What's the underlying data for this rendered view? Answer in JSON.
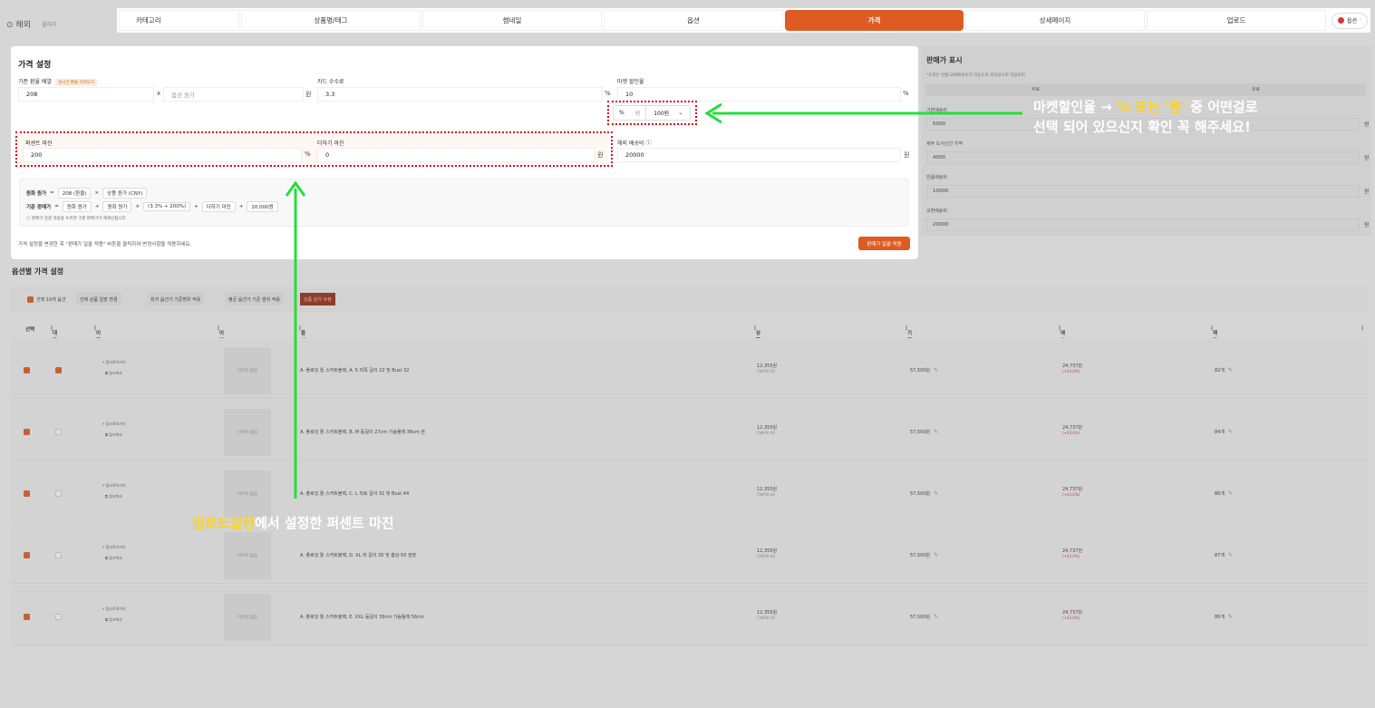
{
  "topbar": {
    "brand": "해외",
    "sub": "불러라"
  },
  "tabs": [
    {
      "label": "카테고리",
      "active": false
    },
    {
      "label": "상품명/태그",
      "active": false
    },
    {
      "label": "썸네일",
      "active": false
    },
    {
      "label": "옵션",
      "active": false
    },
    {
      "label": "가격",
      "active": true
    },
    {
      "label": "상세페이지",
      "active": false
    },
    {
      "label": "업로드",
      "active": false
    }
  ],
  "lang": {
    "label": "옵션"
  },
  "price_settings": {
    "title": "가격 설정",
    "base_rate_label": "기준 환율 배열",
    "base_rate_badge": "실시간 환율 가져오기",
    "base_rate_value": "208",
    "times": "x",
    "option_cost_placeholder": "옵션 원가",
    "won": "원",
    "card_fee_label": "카드 수수료",
    "card_fee_value": "3.3",
    "percent": "%",
    "market_discount_label": "마켓 할인율",
    "market_discount_value": "10",
    "toggle_percent": "%",
    "toggle_won": "원",
    "toggle_select": "100원",
    "percent_margin_label": "퍼센트 마진",
    "percent_margin_value": "200",
    "add_margin_label": "더하기 마진",
    "add_margin_value": "0",
    "overseas_shipping_label": "해외 배송비",
    "overseas_shipping_value": "20000",
    "formula": {
      "row1_label": "원화 원가",
      "eq": "=",
      "row1_chip1": "208 (환율)",
      "mult": "×",
      "row1_chip2": "상품 원가 (CNY)",
      "row2_label": "기준 판매가",
      "row2_chip1": "원화 원가",
      "plus": "+",
      "row2_chip2": "원화 원가",
      "row2_chip3": "(3.3% + 200%)",
      "row2_chip4": "더하기 마진",
      "row2_chip5": "20,000원",
      "note": "판매가 일괄 적용을 누르면 기준 판매가가 재계산됩니다."
    },
    "hint": "가격 설정을 변경한 후 \"판매가 일괄 적용\" 버튼을 클릭하여 변경사항을 적용하세요.",
    "apply_button": "판매가 일괄 적용"
  },
  "sale_display": {
    "title": "판매가 표시",
    "subtitle": "*유료인 반품/교환배송비가 자동으로 최대값으로 적용되며",
    "col1": "무료",
    "col2": "유료",
    "fields": [
      {
        "label": "기본배송비",
        "value": "5000"
      },
      {
        "label": "제주 도서산간 지역",
        "value": "4000"
      },
      {
        "label": "반품배송비",
        "value": "10000"
      },
      {
        "label": "교환배송비",
        "value": "20000"
      }
    ],
    "unit": "원"
  },
  "options": {
    "title": "옵션별 가격 설정",
    "toolbar": {
      "select_count": "선택 10개 옵션",
      "bulk_change": "선택 상품 일괄 변경",
      "min_range": "최저 옵션가 기준범위 적용",
      "avg_range": "평균 옵션가 기준 범위 적용",
      "edit_cost": "상품 원가 수정"
    },
    "headers": {
      "select": "선택",
      "rep": "대표상품",
      "move": "이동",
      "image": "이미지",
      "name": "옵션명",
      "cost": "상품 원가",
      "base_price": "기준 판매가",
      "profit": "예상 순마진",
      "stock": "재고"
    },
    "rows": [
      {
        "checked": true,
        "rep": true,
        "move1": "링크로이가기",
        "move2": "링크복사",
        "image": "이미지 없음",
        "name": "A. 플로잉 톨 스커트블랙, A. S  뒤쪽 길이 22 및 Bust 32",
        "cost": "12,355원",
        "cost_cny": "CN¥59.40",
        "base_price": "57,500원",
        "profit": "24,737원",
        "profit_pct": "(+43.0%)",
        "stock": "82개"
      },
      {
        "checked": true,
        "rep": false,
        "move1": "링크로이가기",
        "move2": "링크복사",
        "image": "이미지 없음",
        "name": "A. 플로잉 톨 스커트블랙, B. M 등길이 27cm 가슴둘레 38cm 권",
        "cost": "12,355원",
        "cost_cny": "CN¥59.40",
        "base_price": "57,500원",
        "profit": "24,737원",
        "profit_pct": "(+43.0%)",
        "stock": "84개"
      },
      {
        "checked": true,
        "rep": false,
        "move1": "링크로이가기",
        "move2": "링크복사",
        "image": "이미지 없음",
        "name": "A. 플로잉 톨 스커트블랙, C. L  뒤로 길이 31 및 Bust 44",
        "cost": "12,355원",
        "cost_cny": "CN¥59.40",
        "base_price": "57,500원",
        "profit": "24,737원",
        "profit_pct": "(+43.0%)",
        "stock": "86개"
      },
      {
        "checked": true,
        "rep": false,
        "move1": "링크로이가기",
        "move2": "링크복사",
        "image": "이미지 없음",
        "name": "A. 플로잉 톨 스커트블랙, D. XL  뒤 길이 35 및 흉상 50 권장",
        "cost": "12,355원",
        "cost_cny": "CN¥59.40",
        "base_price": "57,500원",
        "profit": "24,737원",
        "profit_pct": "(+43.0%)",
        "stock": "87개"
      },
      {
        "checked": true,
        "rep": false,
        "move1": "링크로이가기",
        "move2": "링크복사",
        "image": "이미지 없음",
        "name": "A. 플로잉 톨 스커트블랙, E. XXL 등길이 39cm 가슴둘레 56cm",
        "cost": "12,355원",
        "cost_cny": "CN¥59.40",
        "base_price": "57,500원",
        "profit": "24,737원",
        "profit_pct": "(+43.0%)",
        "stock": "86개"
      }
    ]
  },
  "annotations": {
    "right_line1_a": "마켓할인율 → ",
    "right_line1_b": "% 또는 '원'",
    "right_line1_c": " 중 어떤걸로",
    "right_line2": "선택 되어 있으신지 확인 꼭 해주세요!",
    "bottom_a": "업로드설정",
    "bottom_b": "에서 설정한  퍼센트 마진"
  },
  "colors": {
    "accent": "#de5b22",
    "annotation_green": "#22e03a",
    "annotation_red": "#e0001a",
    "highlight_yellow": "#ffd21f"
  }
}
